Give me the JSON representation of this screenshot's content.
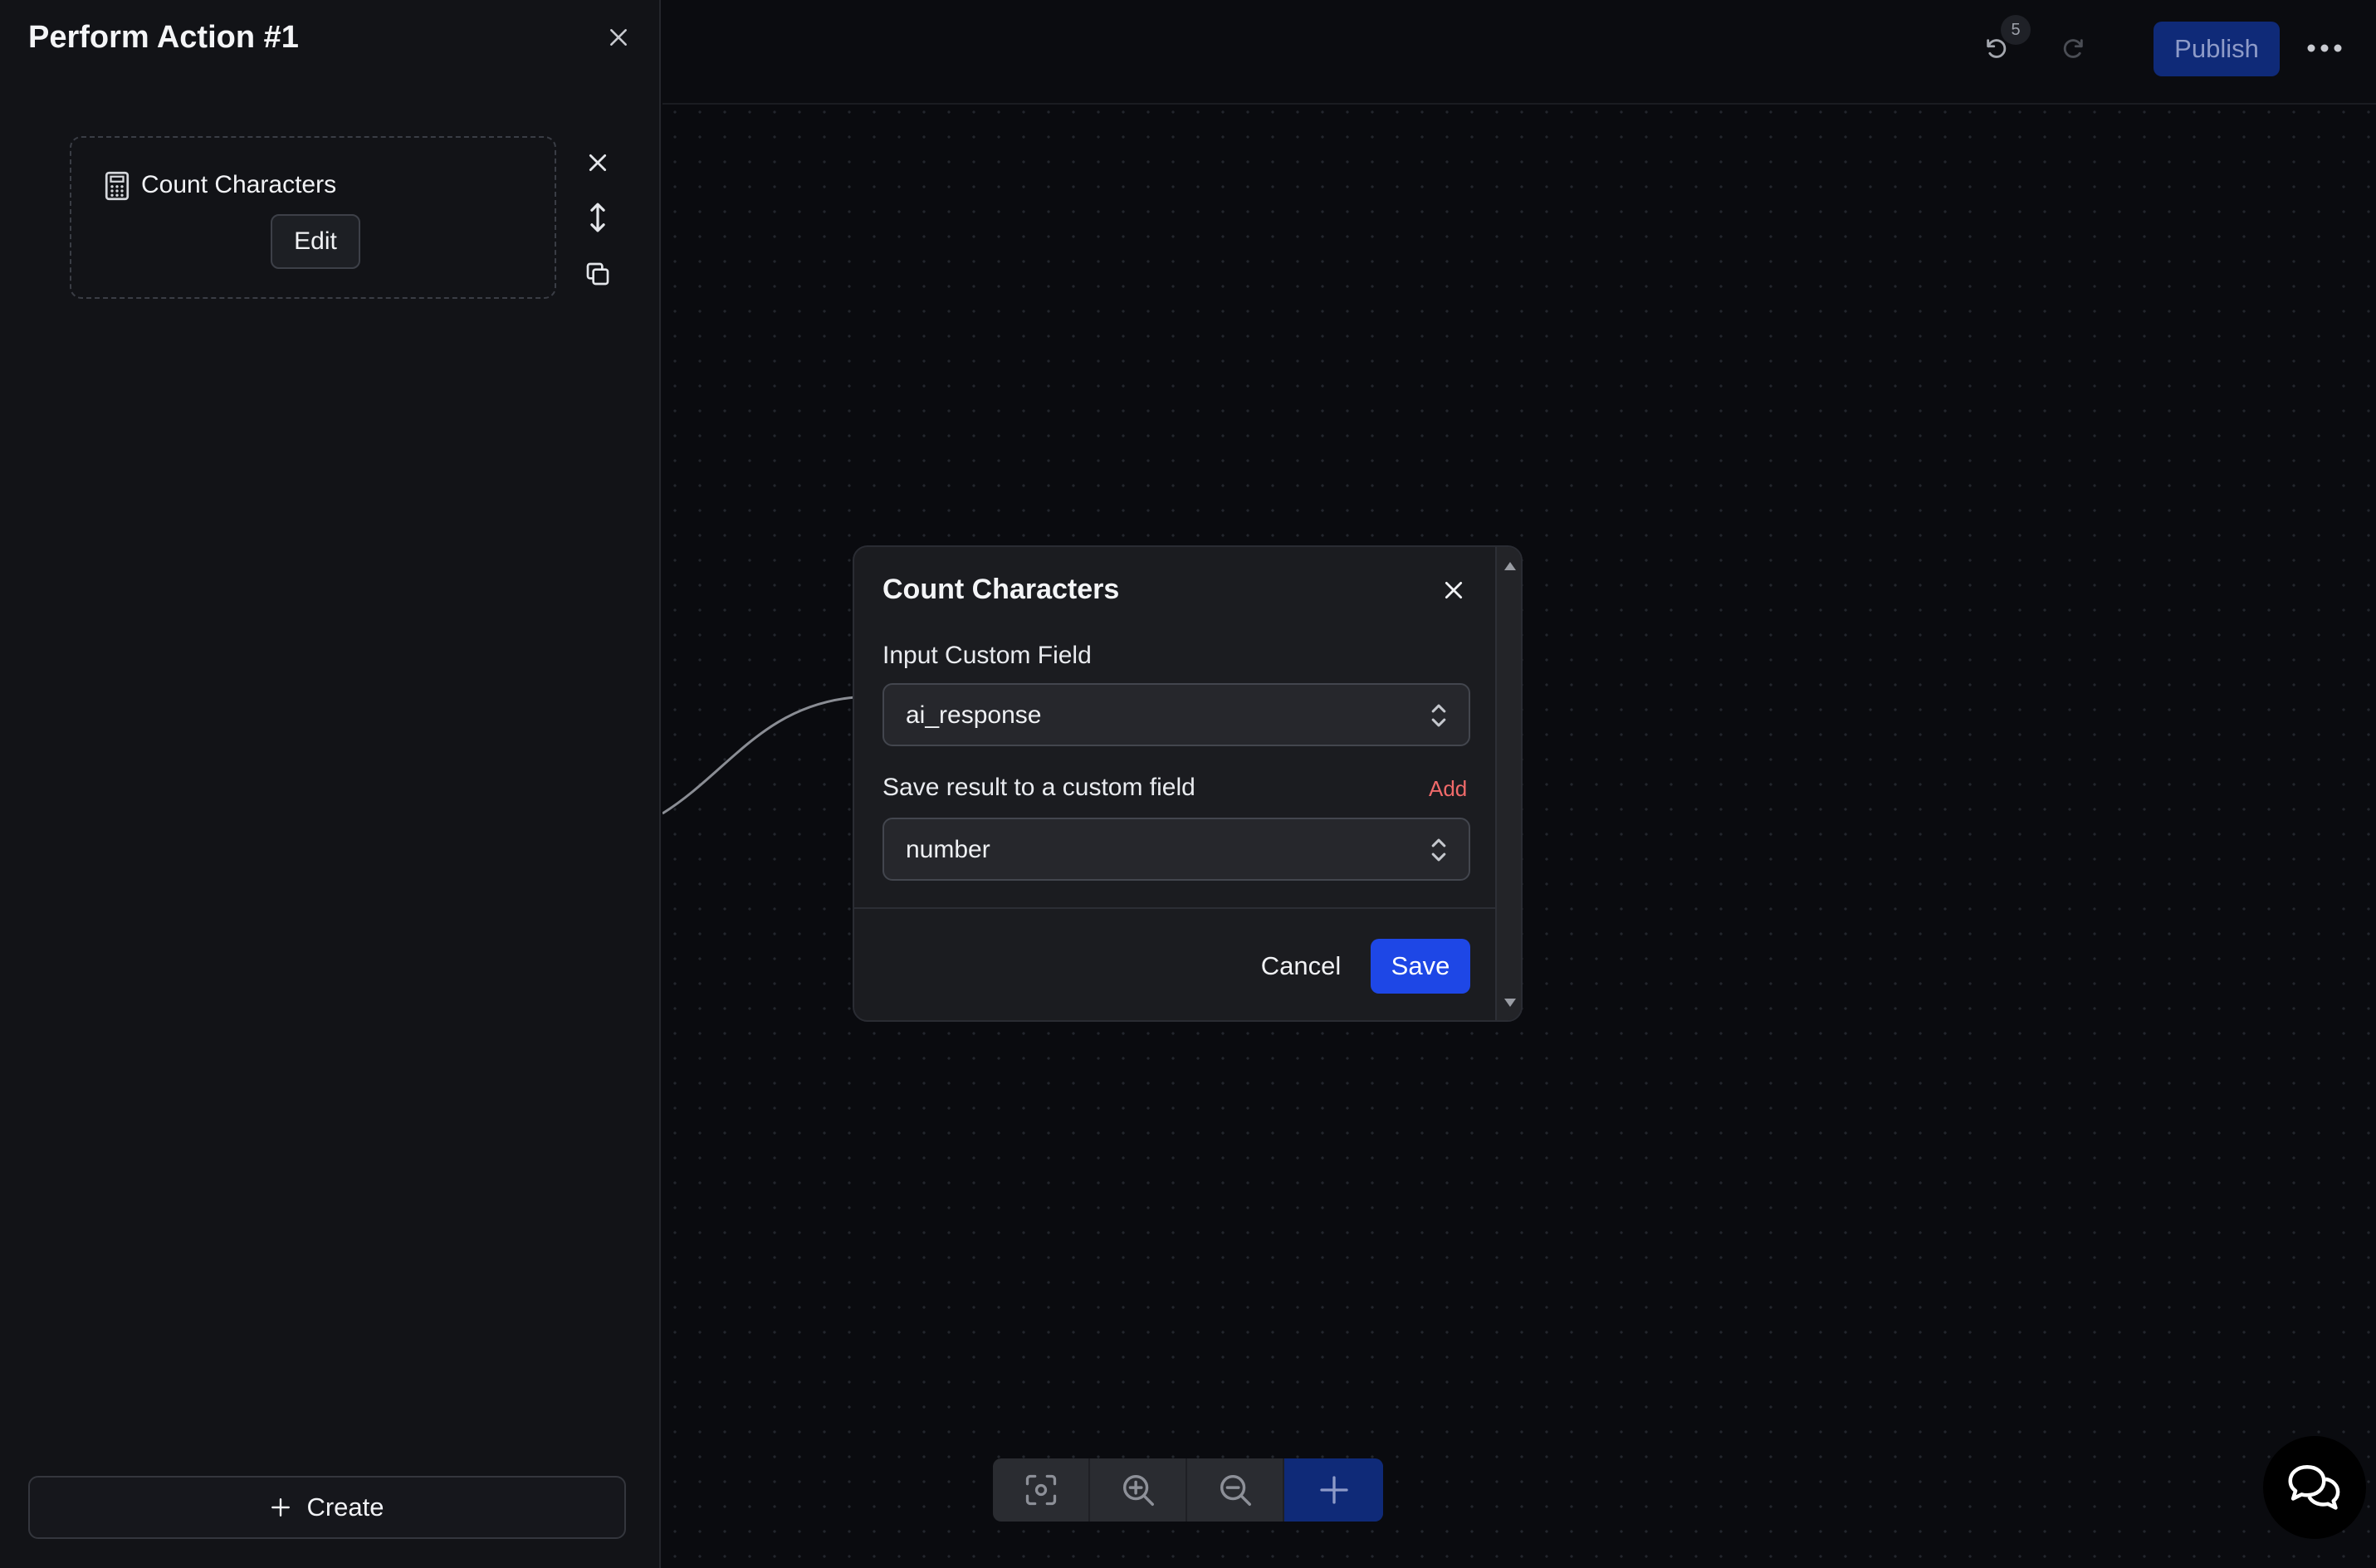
{
  "left_panel": {
    "title": "Perform Action #1",
    "action_card": {
      "title": "Count Characters",
      "edit_label": "Edit",
      "icon": "calculator-icon"
    },
    "create_label": "Create"
  },
  "topbar": {
    "undo_count": "5",
    "publish_label": "Publish"
  },
  "modal": {
    "title": "Count Characters",
    "input_field": {
      "label": "Input Custom Field",
      "value": "ai_response"
    },
    "output_field": {
      "label": "Save result to a custom field",
      "add_label": "Add",
      "value": "number"
    },
    "cancel_label": "Cancel",
    "save_label": "Save"
  },
  "colors": {
    "accent": "#1e47e6",
    "publish_bg": "#0f2a78",
    "add_link": "#f06a6a",
    "panel_bg": "#121317",
    "canvas_bg": "#0a0b0f"
  }
}
